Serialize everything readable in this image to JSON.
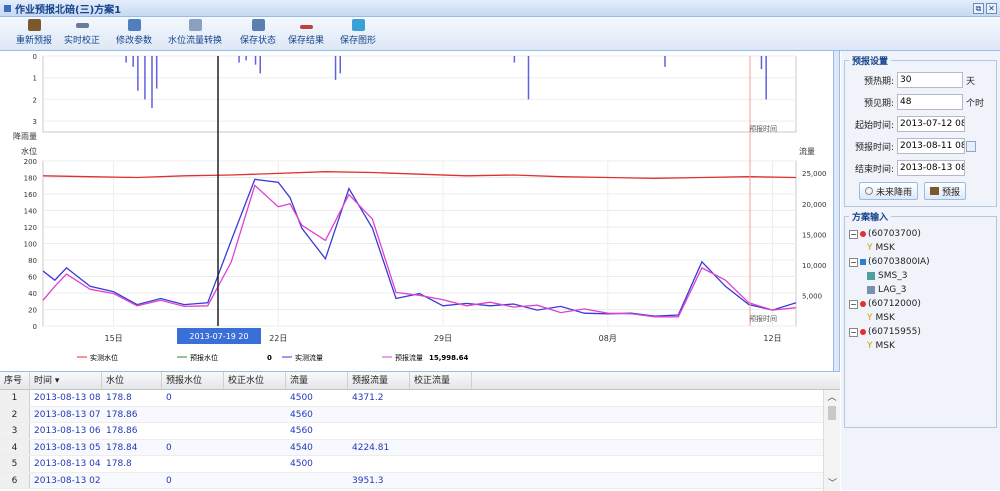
{
  "window": {
    "title": "作业预报北碚(三)方案1",
    "btn_restore": "⧉",
    "btn_close": "✕"
  },
  "toolbar": [
    {
      "label": "重新预报",
      "icon": "forecast-icon",
      "color": "#7a5a2a"
    },
    {
      "label": "实时校正",
      "icon": "correction-icon",
      "color": "#6b7b9a"
    },
    {
      "label": "修改参数",
      "icon": "params-icon",
      "color": "#4f7fc0"
    },
    {
      "label": "水位流量转换",
      "icon": "convert-icon",
      "color": "#8aa0c0"
    },
    {
      "label": "保存状态",
      "icon": "save-state-icon",
      "color": "#5a7fb0"
    },
    {
      "label": "保存结果",
      "icon": "save-result-icon",
      "color": "#c04040"
    },
    {
      "label": "保存图形",
      "icon": "save-graph-icon",
      "color": "#3aa0d8"
    }
  ],
  "chart": {
    "colors": {
      "stage": "#e03030",
      "forecast_stage": "#2a8a2a",
      "flow": "#3a3ad8",
      "forecast_flow": "#e040d0",
      "rain": "#6060e0"
    },
    "rain_axis": {
      "ticks": [
        "0",
        "1",
        "2",
        "3"
      ],
      "label": "降雨量"
    },
    "stage_axis": {
      "label": "水位",
      "ticks": [
        "200",
        "180",
        "160",
        "140",
        "120",
        "100",
        "80",
        "60",
        "40",
        "20",
        "0"
      ]
    },
    "flow_axis": {
      "label": "流量",
      "ticks": [
        "25,000",
        "20,000",
        "15,000",
        "10,000",
        "5,000"
      ]
    },
    "x_ticks": [
      "15日",
      "22日",
      "29日",
      "08月",
      "12日"
    ],
    "cursor_label": "2013-07-19 20",
    "forecast_label_top": "预报时间",
    "forecast_label_bottom": "预报时间",
    "legend": [
      {
        "label": "实测水位",
        "value": ""
      },
      {
        "label": "预报水位",
        "value": "0"
      },
      {
        "label": "实测流量",
        "value": ""
      },
      {
        "label": "预报流量",
        "value": "15,998.64"
      }
    ]
  },
  "chart_data": {
    "type": "line",
    "x_range": [
      "2013-07-12 08",
      "2013-08-13 08"
    ],
    "rain_ylim": [
      0,
      3.5
    ],
    "stage_ylim": [
      0,
      200
    ],
    "flow_ylim": [
      0,
      27000
    ],
    "series": [
      {
        "name": "实测水位",
        "axis": "stage",
        "x": [
          0,
          2,
          4,
          6,
          8,
          10,
          12,
          14,
          16,
          18,
          20,
          22,
          24,
          26,
          28,
          30,
          32
        ],
        "values": [
          182,
          181,
          180,
          182,
          183,
          185,
          187,
          186,
          184,
          182,
          183,
          181,
          180,
          179,
          180,
          181,
          180
        ]
      },
      {
        "name": "实测流量",
        "axis": "flow",
        "x": [
          0,
          0.5,
          1,
          2,
          3,
          4,
          5,
          6,
          7,
          8,
          9,
          10,
          10.5,
          11,
          12,
          13,
          14,
          15,
          16,
          17,
          18,
          19,
          20,
          21,
          22,
          23,
          24,
          25,
          26,
          27,
          28,
          29,
          30,
          31,
          32
        ],
        "values": [
          9000,
          7500,
          9500,
          6500,
          5600,
          3500,
          4500,
          3500,
          3800,
          14000,
          24000,
          23500,
          21000,
          16000,
          11000,
          22500,
          16000,
          4500,
          5300,
          3300,
          3700,
          3300,
          3600,
          2600,
          3200,
          2100,
          2000,
          2100,
          1600,
          1800,
          10500,
          6500,
          3500,
          2600,
          3800
        ]
      },
      {
        "name": "预报流量",
        "axis": "flow",
        "x": [
          0,
          0.5,
          1,
          2,
          3,
          4,
          5,
          6,
          7,
          8,
          9,
          10,
          10.5,
          11,
          12,
          13,
          14,
          15,
          16,
          17,
          18,
          19,
          20,
          21,
          22,
          23,
          24,
          25,
          26,
          27,
          28,
          29,
          30,
          31,
          32
        ],
        "values": [
          4200,
          6500,
          8500,
          6000,
          5300,
          3300,
          4200,
          3200,
          3300,
          10500,
          23000,
          19500,
          20000,
          16500,
          14000,
          21500,
          17500,
          5500,
          5000,
          4300,
          3300,
          3900,
          3100,
          3400,
          2200,
          2800,
          2100,
          2000,
          1500,
          1500,
          9500,
          7500,
          3800,
          2600,
          3000
        ]
      },
      {
        "name": "降雨量",
        "axis": "rain",
        "x": [
          3.5,
          3.8,
          4,
          4.3,
          4.6,
          4.8,
          8.3,
          8.6,
          9,
          9.2,
          12.4,
          12.6,
          20,
          20.6,
          26.4,
          30.5,
          30.7
        ],
        "values": [
          0.3,
          0.5,
          1.6,
          2.0,
          2.4,
          1.5,
          0.3,
          0.2,
          0.4,
          0.8,
          1.1,
          0.8,
          0.3,
          2.0,
          0.5,
          0.6,
          2.0
        ]
      }
    ]
  },
  "settings": {
    "legend": "预报设置",
    "fields": [
      {
        "label": "预热期:",
        "value": "30",
        "unit": "天"
      },
      {
        "label": "预见期:",
        "value": "48",
        "unit": "个时"
      }
    ],
    "dates": [
      {
        "label": "起始时间:",
        "value": "2013-07-12 08"
      },
      {
        "label": "预报时间:",
        "value": "2013-08-11 08"
      },
      {
        "label": "结束时间:",
        "value": "2013-08-13 08"
      }
    ],
    "btn_future_rain": "未来降雨",
    "btn_forecast": "预报"
  },
  "scheme": {
    "legend": "方案输入",
    "nodes": [
      {
        "text": "(60703700)",
        "child": "MSK"
      },
      {
        "text": "(60703800IA)",
        "children": [
          "SMS_3",
          "LAG_3"
        ]
      },
      {
        "text": "(60712000)",
        "child": "MSK"
      },
      {
        "text": "(60715955)",
        "child": "MSK"
      }
    ]
  },
  "grid": {
    "columns": [
      "序号",
      "时间 ▾",
      "水位",
      "预报水位",
      "校正水位",
      "流量",
      "预报流量",
      "校正流量"
    ],
    "rows": [
      [
        "1",
        "2013-08-13 08",
        "178.8",
        "0",
        "",
        "4500",
        "4371.2",
        ""
      ],
      [
        "2",
        "2013-08-13 07",
        "178.86",
        "",
        "",
        "4560",
        "",
        ""
      ],
      [
        "3",
        "2013-08-13 06",
        "178.86",
        "",
        "",
        "4560",
        "",
        ""
      ],
      [
        "4",
        "2013-08-13 05",
        "178.84",
        "0",
        "",
        "4540",
        "4224.81",
        ""
      ],
      [
        "5",
        "2013-08-13 04",
        "178.8",
        "",
        "",
        "4500",
        "",
        ""
      ],
      [
        "6",
        "2013-08-13 02",
        "",
        "0",
        "",
        "",
        "3951.3",
        ""
      ]
    ]
  }
}
